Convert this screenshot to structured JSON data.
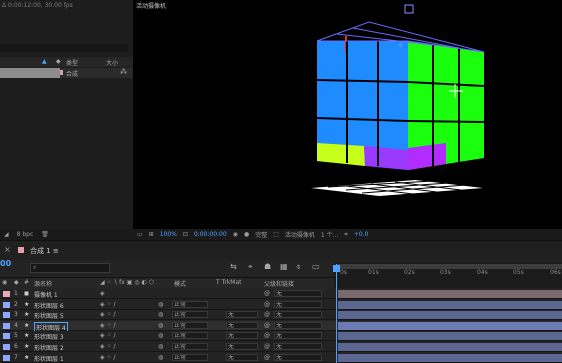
{
  "project_panel": {
    "info": "Δ 0:00:12:00, 30.00 fps",
    "col_type": "类型",
    "col_size": "大小",
    "item_type": "合成",
    "footer_bits": "8 bpc"
  },
  "viewer": {
    "tab_label": "活动摄像机",
    "zoom": "100%",
    "time": "0:00:00:00",
    "quality": "完整",
    "camera": "活动摄像机",
    "views": "1 个...",
    "exposure": "+0.0"
  },
  "timeline": {
    "tab_label": "合成 1",
    "current_time": "00",
    "ruler_ticks": [
      "0s",
      "01s",
      "02s",
      "03s",
      "04s",
      "05s",
      "06s"
    ],
    "headers": {
      "num": "#",
      "source_name": "源名称",
      "mode": "模式",
      "trkmat": "T  TrkMat",
      "parent": "父级和链接"
    },
    "layers": [
      {
        "num": "1",
        "name": "摄像机 1",
        "mode": "",
        "trkmat": "",
        "parent": "无",
        "label_color": "#e6a9b8",
        "bar_color": "#7a6a6f"
      },
      {
        "num": "2",
        "name": "形状图层 6",
        "mode": "正常",
        "trkmat": "",
        "parent": "无",
        "label_color": "#8fa7ff",
        "bar_color": "#5b6790"
      },
      {
        "num": "3",
        "name": "形状图层 5",
        "mode": "正常",
        "trkmat": "无",
        "parent": "无",
        "label_color": "#8fa7ff",
        "bar_color": "#5b6790"
      },
      {
        "num": "4",
        "name": "形状图层 4",
        "mode": "正常",
        "trkmat": "无",
        "parent": "无",
        "label_color": "#8fa7ff",
        "bar_color": "#6c7bb3"
      },
      {
        "num": "5",
        "name": "形状图层 3",
        "mode": "正常",
        "trkmat": "无",
        "parent": "无",
        "label_color": "#8fa7ff",
        "bar_color": "#5b6790"
      },
      {
        "num": "6",
        "name": "形状图层 2",
        "mode": "正常",
        "trkmat": "无",
        "parent": "无",
        "label_color": "#8fa7ff",
        "bar_color": "#5b6790"
      },
      {
        "num": "7",
        "name": "形状图层 1",
        "mode": "正常",
        "trkmat": "无",
        "parent": "无",
        "label_color": "#8fa7ff",
        "bar_color": "#5b6790"
      }
    ]
  },
  "colors": {
    "accent": "#4da3ff",
    "cube_blue": "#1e8cff",
    "cube_green": "#19ff0e",
    "cube_yellowgreen": "#c6ff1a",
    "cube_purple": "#b02cff",
    "cube_red": "#ff2222"
  }
}
